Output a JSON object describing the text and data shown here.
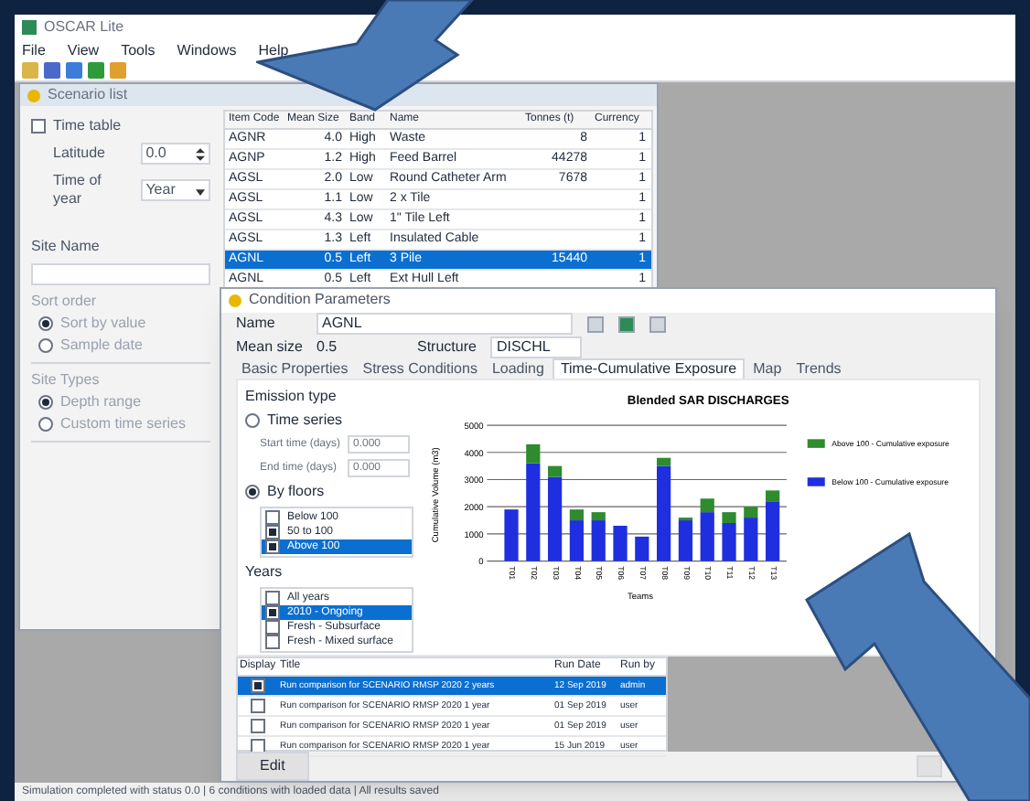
{
  "window": {
    "title": "OSCAR Lite"
  },
  "menu": [
    "File",
    "View",
    "Tools",
    "Windows",
    "Help"
  ],
  "child_window": {
    "title": "Scenario list",
    "time_table": {
      "label": "Time table",
      "checked": false
    },
    "fields": [
      {
        "label": "Latitude",
        "value": "0.0",
        "kind": "spin"
      },
      {
        "label": "Time of year",
        "value": "Year",
        "kind": "drop"
      }
    ],
    "site_name": {
      "label": "Site Name"
    },
    "groups": [
      {
        "title": "Sort order",
        "options": [
          {
            "label": "Sort by value",
            "selected": true
          },
          {
            "label": "Sample date",
            "selected": false
          }
        ]
      },
      {
        "title": "Site Types",
        "options": [
          {
            "label": "Depth range",
            "selected": true
          },
          {
            "label": "Custom time series",
            "selected": false
          }
        ]
      }
    ],
    "table": {
      "columns": [
        "Item Code",
        "Mean Size",
        "Band",
        "Name",
        "Tonnes (t)",
        "Currency"
      ],
      "rows": [
        {
          "cells": [
            "AGNR",
            "4.0",
            "High",
            "Waste",
            "8",
            "1"
          ],
          "selected": false
        },
        {
          "cells": [
            "AGNP",
            "1.2",
            "High",
            "Feed Barrel",
            "44278",
            "1"
          ],
          "selected": false
        },
        {
          "cells": [
            "AGSL",
            "2.0",
            "Low",
            "Round Catheter Arm",
            "7678",
            "1"
          ],
          "selected": false
        },
        {
          "cells": [
            "AGSL",
            "1.1",
            "Low",
            "2 x Tile",
            "",
            "1"
          ],
          "selected": false
        },
        {
          "cells": [
            "AGSL",
            "4.3",
            "Low",
            "1\" Tile Left",
            "",
            "1"
          ],
          "selected": false
        },
        {
          "cells": [
            "AGSL",
            "1.3",
            "Left",
            "Insulated Cable",
            "",
            "1"
          ],
          "selected": false
        },
        {
          "cells": [
            "AGNL",
            "0.5",
            "Left",
            "3 Pile",
            "15440",
            "1"
          ],
          "selected": true
        },
        {
          "cells": [
            "AGNL",
            "0.5",
            "Left",
            "Ext Hull Left",
            "",
            "1"
          ],
          "selected": false
        }
      ]
    }
  },
  "dialog": {
    "title": "Condition Parameters",
    "name": {
      "label": "Name",
      "value": "AGNL"
    },
    "mean_size": {
      "label": "Mean size",
      "value": "0.5"
    },
    "structure": {
      "label": "Structure",
      "value": "DISCHL"
    },
    "tabs": [
      {
        "label": "Basic Properties",
        "selected": false
      },
      {
        "label": "Stress Conditions",
        "selected": false
      },
      {
        "label": "Loading",
        "selected": false
      },
      {
        "label": "Time-Cumulative Exposure",
        "selected": true
      },
      {
        "label": "Map",
        "selected": false
      },
      {
        "label": "Trends",
        "selected": false
      }
    ],
    "emission": {
      "title": "Emission type",
      "option": {
        "label": "Time series",
        "selected": false
      },
      "fields": [
        {
          "label": "Start time (days)",
          "value": "0.000"
        },
        {
          "label": "End time (days)",
          "value": "0.000"
        }
      ],
      "floors": {
        "label": "By floors",
        "selected": true
      },
      "floor_items": [
        {
          "label": "Below 100",
          "checked": false,
          "selected": false
        },
        {
          "label": "50 to 100",
          "checked": true,
          "selected": false
        },
        {
          "label": "Above 100",
          "checked": true,
          "selected": true
        }
      ],
      "years_title": "Years",
      "year_items": [
        {
          "label": "All years",
          "checked": false,
          "selected": false
        },
        {
          "label": "2010 - Ongoing",
          "checked": true,
          "selected": true
        },
        {
          "label": "Fresh - Subsurface",
          "checked": false,
          "selected": false
        },
        {
          "label": "Fresh - Mixed surface",
          "checked": false,
          "selected": false
        }
      ]
    },
    "chart_data": {
      "type": "bar",
      "stacked": true,
      "title": "Blended SAR DISCHARGES",
      "xlabel": "Teams",
      "ylabel": "Cumulative Volume (m3)",
      "categories": [
        "T01",
        "T02",
        "T03",
        "T04",
        "T05",
        "T06",
        "T07",
        "T08",
        "T09",
        "T10",
        "T11",
        "T12",
        "T13"
      ],
      "grid": true,
      "legend": true,
      "ylim": [
        0,
        5000
      ],
      "yticks": [
        0,
        1000,
        2000,
        3000,
        4000,
        5000
      ],
      "series": [
        {
          "name": "Below 100 - Cumulative exposure",
          "color": "#1f2fe0",
          "values": [
            1900,
            3600,
            3100,
            1500,
            1500,
            1300,
            900,
            3500,
            1500,
            1800,
            1400,
            1600,
            2200
          ]
        },
        {
          "name": "Above 100 - Cumulative exposure",
          "color": "#2e8b2e",
          "values": [
            0,
            700,
            400,
            400,
            300,
            0,
            0,
            300,
            100,
            500,
            400,
            400,
            400
          ]
        }
      ]
    },
    "runs": {
      "columns": [
        "Display",
        "Title",
        "Run Date",
        "Run by"
      ],
      "rows": [
        {
          "checked": true,
          "selected": true,
          "cells": [
            "",
            "Run comparison for SCENARIO RMSP 2020 2 years",
            "12 Sep 2019",
            "admin"
          ]
        },
        {
          "checked": false,
          "selected": false,
          "cells": [
            "",
            "Run comparison for SCENARIO RMSP 2020 1 year",
            "01 Sep 2019",
            "user"
          ]
        },
        {
          "checked": false,
          "selected": false,
          "cells": [
            "",
            "Run comparison for SCENARIO RMSP 2020 1 year",
            "01 Sep 2019",
            "user"
          ]
        },
        {
          "checked": false,
          "selected": false,
          "cells": [
            "",
            "Run comparison for SCENARIO RMSP 2020 1 year",
            "15 Jun 2019",
            "user"
          ]
        }
      ]
    },
    "buttons": [
      "Edit"
    ]
  },
  "status_bar": "Simulation completed with status 0.0 | 6 conditions with loaded data | All results saved"
}
